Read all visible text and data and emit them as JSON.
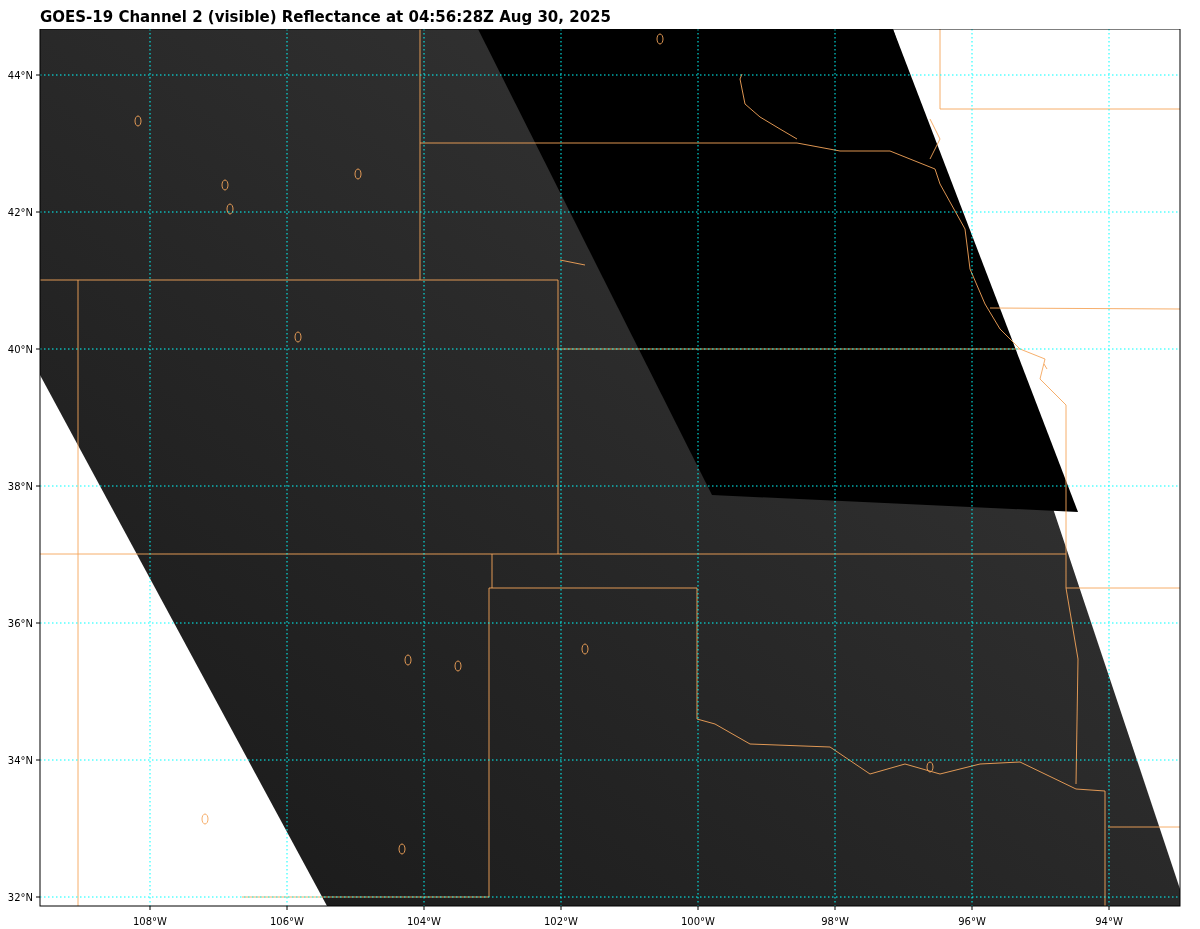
{
  "title": "GOES-19 Channel 2 (visible) Reflectance at 04:56:28Z Aug 30, 2025",
  "latitude_labels": [
    "44°N",
    "42°N",
    "40°N",
    "38°N",
    "36°N",
    "34°N",
    "32°N"
  ],
  "longitude_labels": [
    "108°W",
    "106°W",
    "104°W",
    "102°W",
    "100°W",
    "98°W",
    "96°W",
    "94°W"
  ]
}
